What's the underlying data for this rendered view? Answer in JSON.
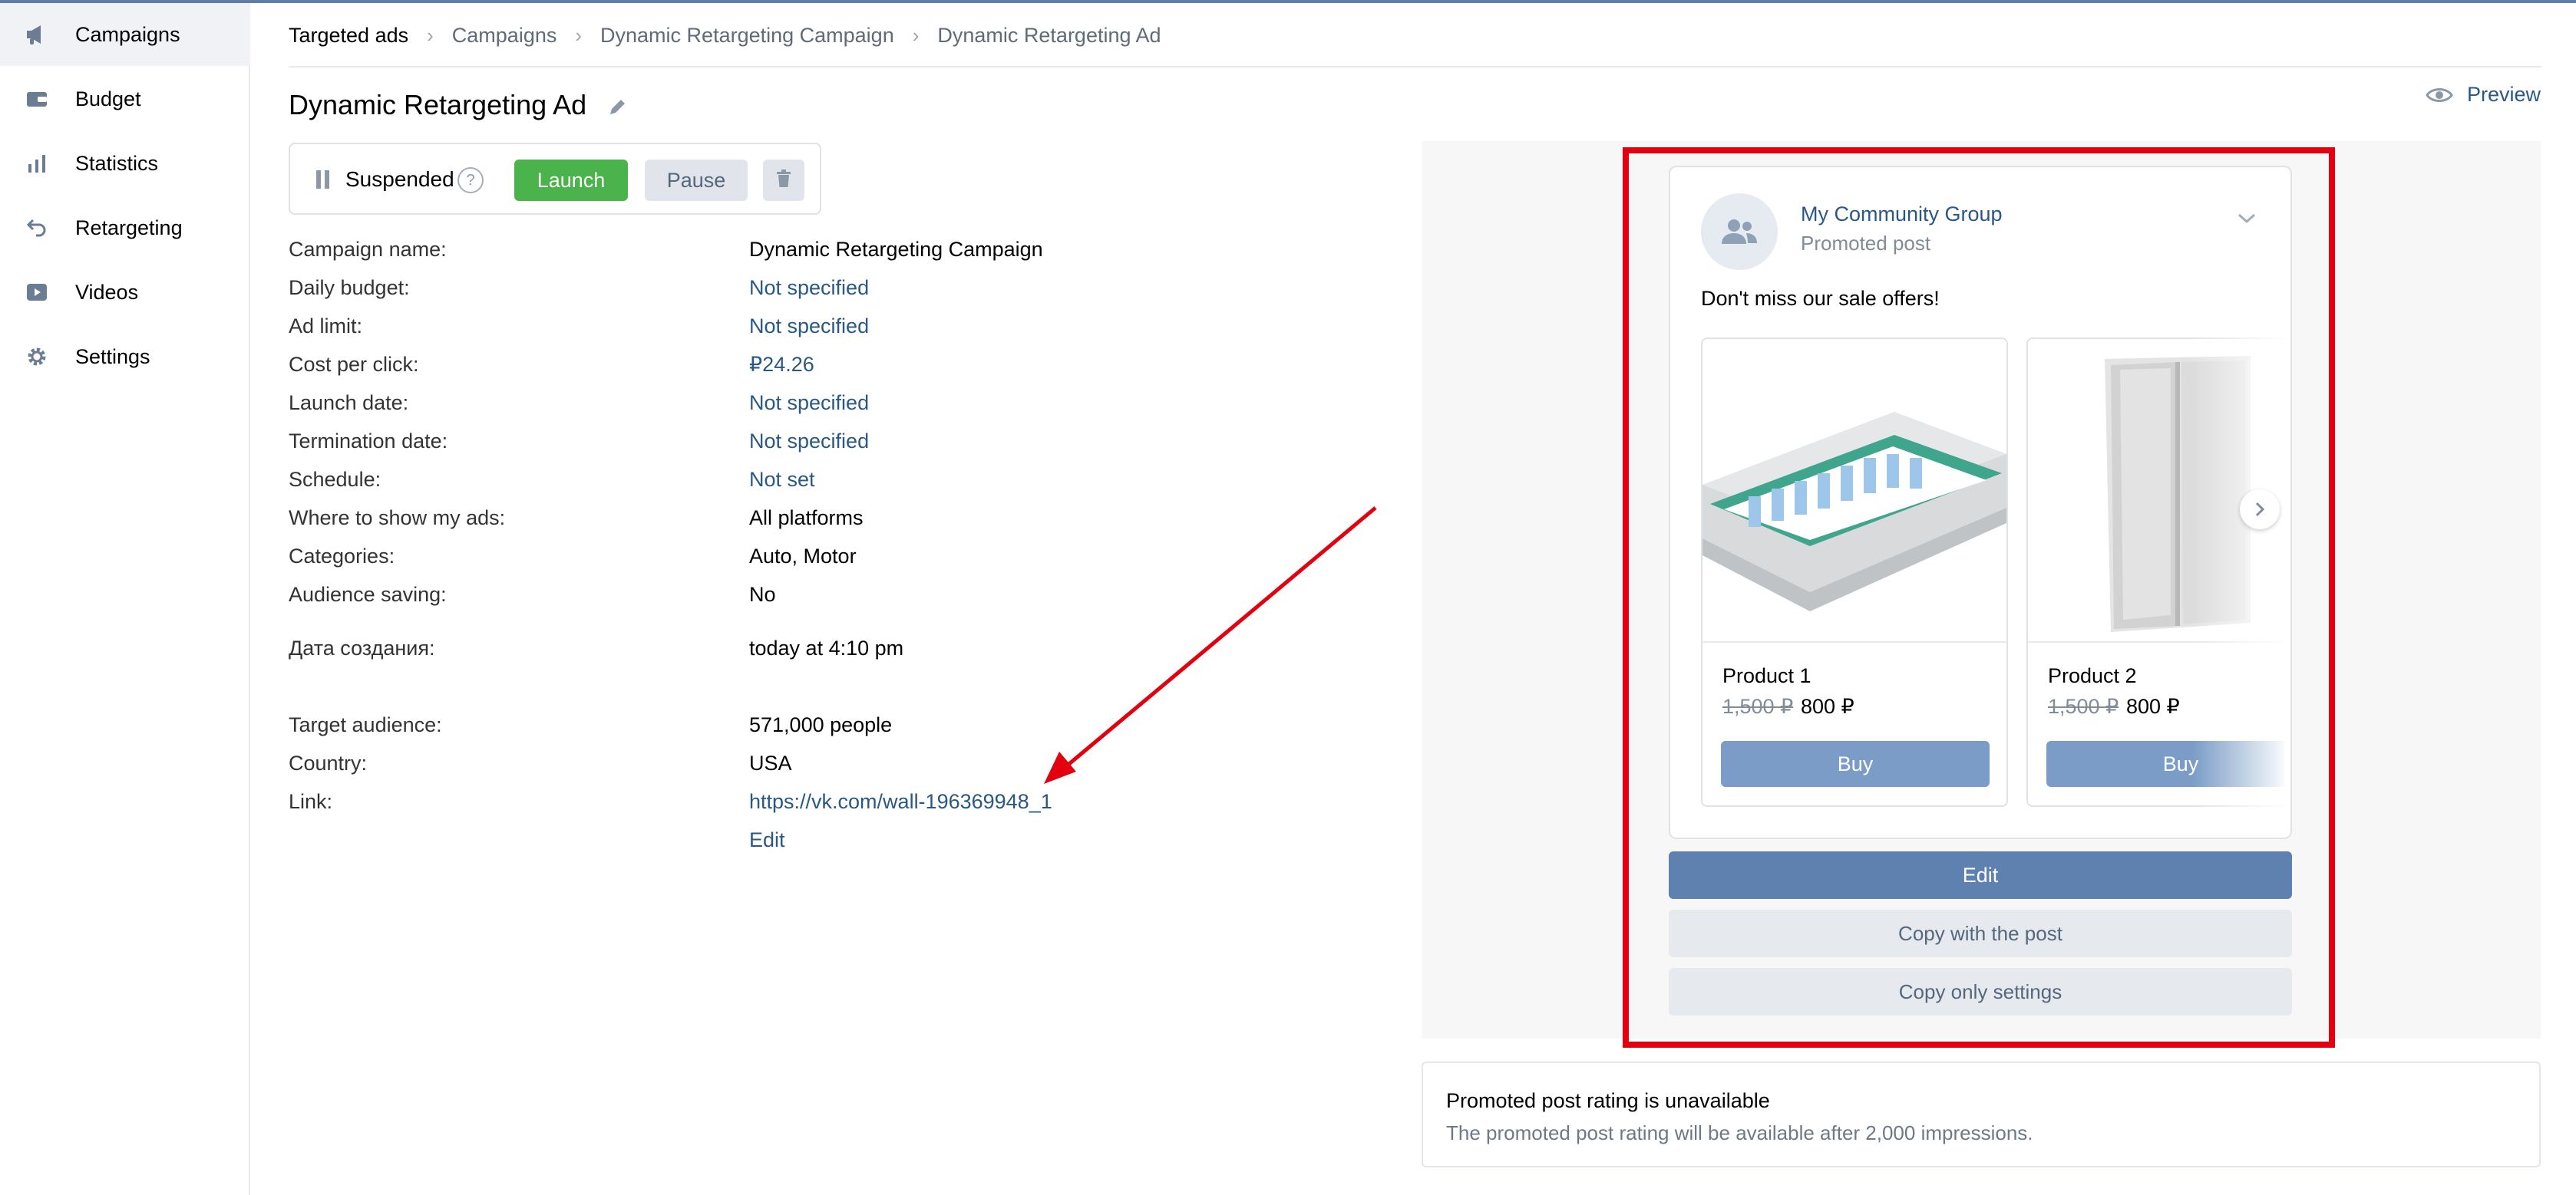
{
  "sidebar": {
    "items": [
      {
        "label": "Campaigns",
        "icon": "megaphone-icon",
        "active": true
      },
      {
        "label": "Budget",
        "icon": "wallet-icon"
      },
      {
        "label": "Statistics",
        "icon": "bar-chart-icon"
      },
      {
        "label": "Retargeting",
        "icon": "retargeting-arrow-icon"
      },
      {
        "label": "Videos",
        "icon": "video-play-icon"
      },
      {
        "label": "Settings",
        "icon": "gear-icon"
      }
    ]
  },
  "breadcrumb": [
    "Targeted ads",
    "Campaigns",
    "Dynamic Retargeting Campaign",
    "Dynamic Retargeting Ad"
  ],
  "page_title": "Dynamic Retargeting Ad",
  "preview_label": "Preview",
  "status": {
    "label": "Suspended",
    "help": "?",
    "launch": "Launch",
    "pause": "Pause"
  },
  "details": [
    {
      "key": "Campaign name:",
      "value": "Dynamic Retargeting Campaign",
      "link": false
    },
    {
      "key": "Daily budget:",
      "value": "Not specified",
      "link": true
    },
    {
      "key": "Ad limit:",
      "value": "Not specified",
      "link": true
    },
    {
      "key": "Cost per click:",
      "value": "₽24.26",
      "link": true
    },
    {
      "key": "Launch date:",
      "value": "Not specified",
      "link": true
    },
    {
      "key": "Termination date:",
      "value": "Not specified",
      "link": true
    },
    {
      "key": "Schedule:",
      "value": "Not set",
      "link": true
    },
    {
      "key": "Where to show my ads:",
      "value": "All platforms",
      "link": false
    },
    {
      "key": "Categories:",
      "value": "Auto, Motor",
      "link": false
    },
    {
      "key": "Audience saving:",
      "value": "No",
      "link": false
    },
    {
      "key": "Дата создания:",
      "value": "today at 4:10 pm",
      "link": false
    },
    {
      "key": "Target audience:",
      "value": "571,000 people",
      "link": false
    },
    {
      "key": "Country:",
      "value": "USA",
      "link": false
    },
    {
      "key": "Link:",
      "value": "https://vk.com/wall-196369948_1",
      "link": true
    },
    {
      "key": "",
      "value": "Edit",
      "link": true
    }
  ],
  "post": {
    "group_name": "My Community Group",
    "subtitle": "Promoted post",
    "text": "Don't miss our sale offers!",
    "products": [
      {
        "name": "Product 1",
        "old_price": "1,500 ₽",
        "price": "800 ₽",
        "buy": "Buy",
        "image": "mattress-image"
      },
      {
        "name": "Product 2",
        "old_price": "1,500 ₽",
        "price": "800 ₽",
        "buy": "Buy",
        "image": "wardrobe-image"
      }
    ]
  },
  "actions": {
    "edit": "Edit",
    "copy_with_post": "Copy with the post",
    "copy_settings": "Copy only settings"
  },
  "rating": {
    "title": "Promoted post rating is unavailable",
    "description": "The promoted post rating will be available after 2,000 impressions."
  },
  "colors": {
    "accent": "#2a5885",
    "launch_green": "#4bb34b",
    "highlight_red": "#e3000f",
    "edit_blue": "#5f81b0"
  }
}
